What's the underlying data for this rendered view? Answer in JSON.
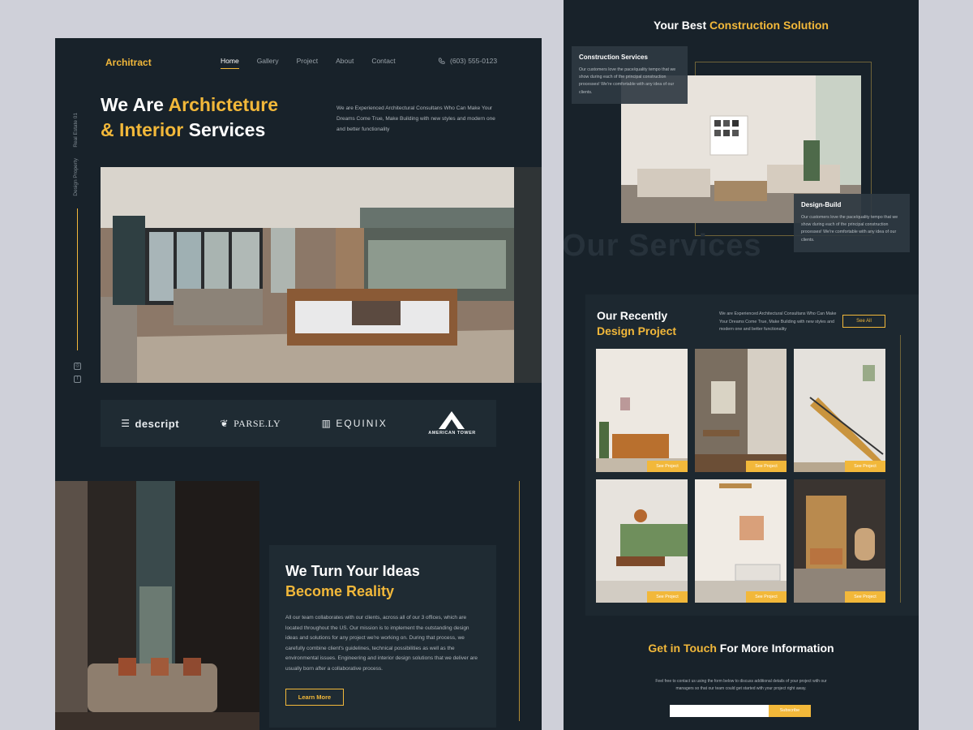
{
  "left": {
    "logo": "Architract",
    "nav": [
      "Home",
      "Gallery",
      "Project",
      "About",
      "Contact"
    ],
    "phone": "(603) 555-0123",
    "hero": {
      "title_white_1": "We Are ",
      "title_yellow_1": "Archicteture",
      "title_yellow_2": "& Interior",
      "title_white_2": " Services",
      "desc": "We are Experienced Architectural Consultans Who Can Make Your Dreams Come True, Make Building with new styles and modern one and better functionality"
    },
    "side": {
      "label_1": "Real Estate 01",
      "label_2": "Design Property"
    },
    "brands": [
      "descript",
      "PARSE.LY",
      "EQUINIX",
      "AMERICAN TOWER"
    ],
    "ideas": {
      "title_white": "We Turn Your Ideas",
      "title_yellow": "Become Reality",
      "text": "All our team collaborates with our clients, across all of our 3 offices, which are located throughout the US. Our mission is to implement the outstanding design ideas and solutions for any project we're working on. During that process, we carefully combine client's guidelines, technical possibilities as well as the environmental issues. Engineering and interior design solutions that we deliver are usually born after a collaborative process.",
      "button": "Learn More"
    }
  },
  "right": {
    "title_white": "Your Best ",
    "title_yellow": "Construction Solution",
    "card1": {
      "title": "Construction Services",
      "text": "Our customers love the pace/quality tempo that we show during each of the principal construction processes! We're comfortable with any idea of our clients."
    },
    "card2": {
      "title": "Design-Build",
      "text": "Our customers love the pace/quality tempo that we show during each of the principal construction processes! We're comfortable with any idea of our clients."
    },
    "faded": "Our Services",
    "projects": {
      "title_white": "Our Recently",
      "title_yellow": "Design Project",
      "desc": "We are Experienced Architectural Consultans Who Can Make Your Dreams Come True, Make Building with new styles and modern one and better functionality",
      "see_all": "See All",
      "tile_label": "See Project"
    },
    "contact": {
      "title_yellow": "Get in Touch",
      "title_white": " For More Information",
      "desc": "Feel free to contact us using the form below to discuss additional details of your project with our managers so that our team could get started with your project right away.",
      "subscribe": "Subscribe"
    }
  }
}
